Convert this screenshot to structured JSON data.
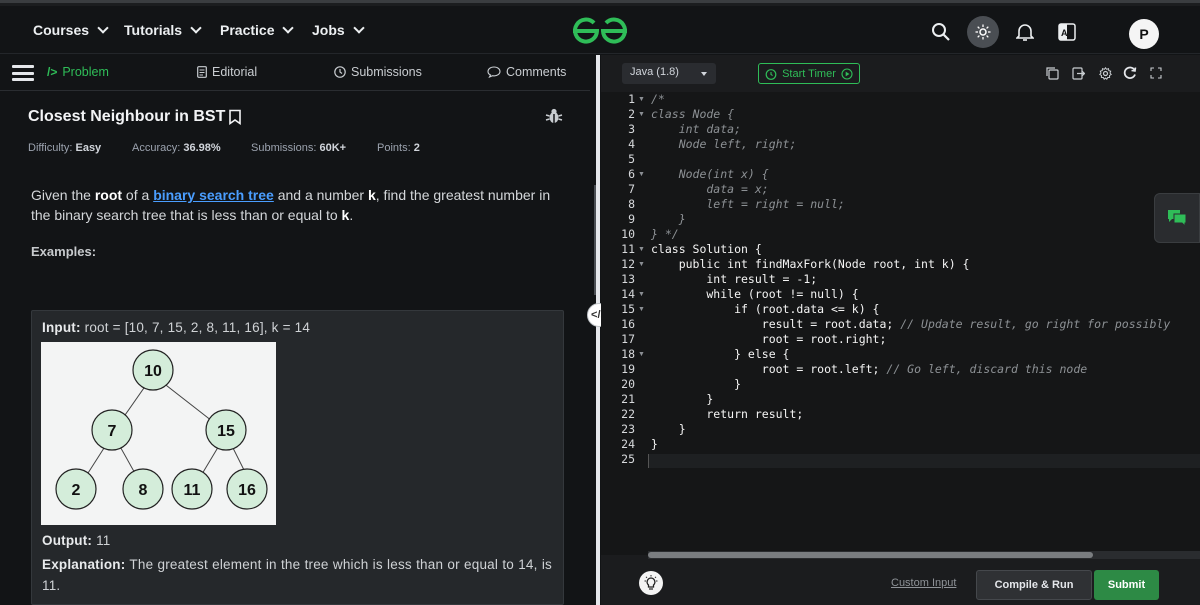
{
  "nav": {
    "items": [
      "Courses",
      "Tutorials",
      "Practice",
      "Jobs"
    ],
    "avatar_letter": "P",
    "translate_icon_text": "A"
  },
  "tabs": {
    "problem": "Problem",
    "editorial": "Editorial",
    "submissions": "Submissions",
    "comments": "Comments"
  },
  "problem": {
    "title": "Closest Neighbour in BST",
    "difficulty_label": "Difficulty:",
    "difficulty": "Easy",
    "accuracy_label": "Accuracy:",
    "accuracy": "36.98%",
    "submissions_label": "Submissions:",
    "submissions": "60K+",
    "points_label": "Points:",
    "points": "2",
    "desc_1": "Given the ",
    "desc_root": "root",
    "desc_2": " of a ",
    "desc_link": "binary search tree",
    "desc_3": " and a number ",
    "desc_k": "k",
    "desc_4": ", find the greatest number in the binary search tree that is less than or equal to ",
    "desc_k2": "k",
    "desc_5": ".",
    "examples_label": "Examples:"
  },
  "example": {
    "input_label": "Input:",
    "input_value": "root = [10, 7, 15, 2, 8, 11, 16], k = 14",
    "output_label": "Output:",
    "output_value": "11",
    "explanation_label": "Explanation:",
    "explanation_value": "The greatest element in the tree which is less than or equal to 14, is 11.",
    "tree_nodes": [
      "10",
      "7",
      "15",
      "2",
      "8",
      "11",
      "16"
    ]
  },
  "editor": {
    "language": "Java (1.8)",
    "timer_label": "Start Timer",
    "line_numbers": [
      "1",
      "2",
      "3",
      "4",
      "5",
      "6",
      "7",
      "8",
      "9",
      "10",
      "11",
      "12",
      "13",
      "14",
      "15",
      "16",
      "17",
      "18",
      "19",
      "20",
      "21",
      "22",
      "23",
      "24",
      "25"
    ],
    "lines": [
      "/*",
      "class Node {",
      "    int data;",
      "    Node left, right;",
      "",
      "    Node(int x) {",
      "        data = x;",
      "        left = right = null;",
      "    }",
      "} */",
      "class Solution {",
      "    public int findMaxFork(Node root, int k) {",
      "        int result = -1;",
      "        while (root != null) {",
      "            if (root.data <= k) {",
      "                result = root.data; ",
      "                root = root.right;",
      "            } else {",
      "                root = root.left; ",
      "            }",
      "        }",
      "        return result;",
      "    }",
      "}",
      ""
    ],
    "comment_16": "// Update result, go right for possibly",
    "comment_19": "// Go left, discard this node"
  },
  "bottom": {
    "custom_input": "Custom Input",
    "compile_run": "Compile & Run",
    "submit": "Submit"
  },
  "colors": {
    "accent_green": "#2fbd58",
    "submit_green": "#2d8a45",
    "link_blue": "#4a9eff"
  }
}
